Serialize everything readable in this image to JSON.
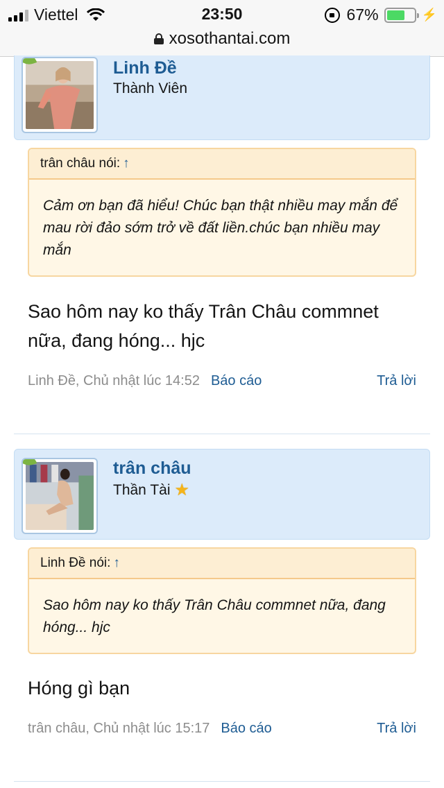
{
  "status_bar": {
    "carrier": "Viettel",
    "time": "23:50",
    "battery_percent": "67%",
    "battery_level": 0.67
  },
  "browser": {
    "url": "xosothantai.com"
  },
  "posts": [
    {
      "author": "Linh Đề",
      "role": "Thành Viên",
      "quote_header": "trân châu nói:",
      "quote_arrow": "↑",
      "quote_text": "Cảm ơn bạn đã hiểu! Chúc bạn thật nhiều may mắn để mau rời đảo sớm trở về đất liền.chúc bạn nhiều may mắn",
      "message": "Sao hôm nay ko thấy Trân Châu commnet nữa, đang hóng... hjc",
      "meta": "Linh Đề, Chủ nhật lúc 14:52",
      "report_label": "Báo cáo",
      "reply_label": "Trả lời"
    },
    {
      "author": "trân châu",
      "role": "Thần Tài",
      "role_icon": "star-icon",
      "quote_header": "Linh Đề nói:",
      "quote_arrow": "↑",
      "quote_text": "Sao hôm nay ko thấy Trân Châu commnet nữa, đang hóng... hjc",
      "message": "Hóng gì bạn",
      "meta": "trân châu, Chủ nhật lúc 15:17",
      "report_label": "Báo cáo",
      "reply_label": "Trả lời"
    }
  ],
  "colors": {
    "link": "#1e5c93",
    "userbar_bg": "#dcebfa",
    "quote_bg": "#fff7e6",
    "quote_border": "#f7d6a0"
  }
}
